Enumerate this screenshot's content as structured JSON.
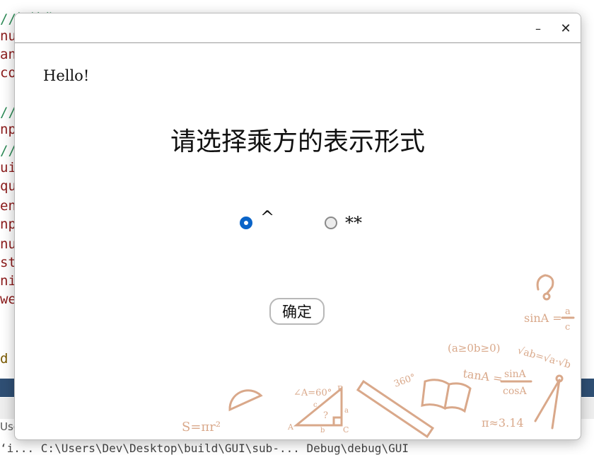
{
  "background": {
    "code_lines": [
      {
        "text": "//初始化",
        "kind": "comment"
      },
      {
        "text": "nu",
        "kind": "code"
      },
      {
        "text": "an",
        "kind": "code"
      },
      {
        "text": "co",
        "kind": "code"
      },
      {
        "text": "//显",
        "kind": "comment"
      },
      {
        "text": "np",
        "kind": "code"
      },
      {
        "text": "//提",
        "kind": "comment"
      },
      {
        "text": "ui-",
        "kind": "code"
      },
      {
        "text": "qu",
        "kind": "code"
      },
      {
        "text": "en",
        "kind": "code"
      },
      {
        "text": "np",
        "kind": "code"
      },
      {
        "text": "nu",
        "kind": "code"
      },
      {
        "text": "sta",
        "kind": "code"
      },
      {
        "text": "nis",
        "kind": "code"
      },
      {
        "text": "we",
        "kind": "code"
      },
      {
        "text": "d I",
        "kind": "kw"
      }
    ],
    "left_tab_text": "Use",
    "path_text": "ʻi... C:\\Users\\Dev\\Desktop\\build\\GUI\\sub-... Debug\\debug\\GUI"
  },
  "dialog": {
    "minimize_glyph": "–",
    "close_glyph": "✕",
    "greeting": "Hello!",
    "question": "请选择乘方的表示形式",
    "options": [
      {
        "label": "^",
        "selected": true
      },
      {
        "label": "**",
        "selected": false
      }
    ],
    "confirm_label": "确定"
  },
  "decoration": {
    "formulas": {
      "sin": "sinA =",
      "sin_num": "a",
      "sin_den": "c",
      "ineq": "(a≥0b≥0)",
      "sqrt": "√ab=√a·√b",
      "tan": "tanA =",
      "tan_num": "sinA",
      "tan_den": "cosA",
      "pi": "π≈3.14",
      "area": "S=πr²",
      "angle": "∠A=60°",
      "deg": "360°",
      "tri_q": "?",
      "tri_a": "A",
      "tri_b": "B",
      "tri_c": "C",
      "tri_sa": "a",
      "tri_sb": "b",
      "tri_sc": "c"
    },
    "accent_color": "#d9a88a",
    "radio_color": "#0a64c8"
  }
}
